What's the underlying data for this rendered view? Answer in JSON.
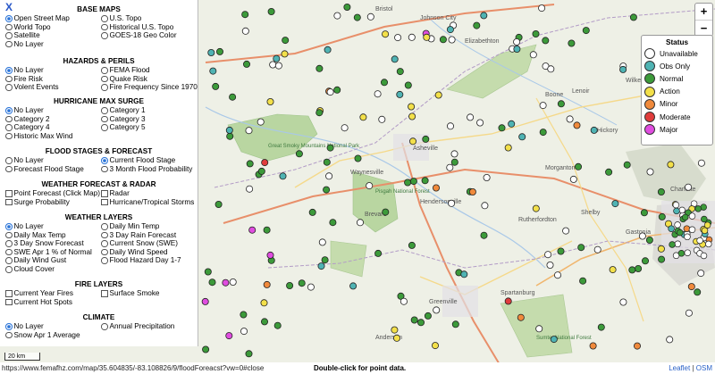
{
  "panel": {
    "close_label": "X",
    "sections": [
      {
        "title": "BASE MAPS",
        "type": "radio",
        "options": [
          {
            "label": "Open Street Map",
            "on": true
          },
          {
            "label": "U.S. Topo",
            "on": false
          },
          {
            "label": "World Topo",
            "on": false
          },
          {
            "label": "Historical U.S. Topo",
            "on": false
          },
          {
            "label": "Satellite",
            "on": false
          },
          {
            "label": "GOES-18 Geo Color",
            "on": false
          },
          {
            "label": "No Layer",
            "on": false
          }
        ]
      },
      {
        "title": "HAZARDS & PERILS",
        "type": "radio",
        "options": [
          {
            "label": "No Layer",
            "on": true
          },
          {
            "label": "FEMA Flood",
            "on": false
          },
          {
            "label": "Fire Risk",
            "on": false
          },
          {
            "label": "Quake Risk",
            "on": false
          },
          {
            "label": "Volent Events",
            "on": false
          },
          {
            "label": "Fire Frequency Since 1970",
            "on": false
          }
        ]
      },
      {
        "title": "HURRICANE MAX SURGE",
        "type": "radio",
        "options": [
          {
            "label": "No Layer",
            "on": true
          },
          {
            "label": "Category 1",
            "on": false
          },
          {
            "label": "Category 2",
            "on": false
          },
          {
            "label": "Category 3",
            "on": false
          },
          {
            "label": "Category 4",
            "on": false
          },
          {
            "label": "Category 5",
            "on": false
          },
          {
            "label": "Historic Max Wind",
            "on": false
          }
        ]
      },
      {
        "title": "FLOOD STAGES & FORECAST",
        "type": "radio",
        "options": [
          {
            "label": "No Layer",
            "on": false
          },
          {
            "label": "Current Flood Stage",
            "on": true
          },
          {
            "label": "Forecast Flood Stage",
            "on": false
          },
          {
            "label": "3 Month Flood Probability",
            "on": false
          }
        ]
      },
      {
        "title": "WEATHER FORECAST & RADAR",
        "type": "check",
        "options": [
          {
            "label": "Point Forecast (Click Map)",
            "on": false
          },
          {
            "label": "Radar",
            "on": false
          },
          {
            "label": "Surge Probability",
            "on": false
          },
          {
            "label": "Hurricane/Tropical Storms",
            "on": false
          }
        ]
      },
      {
        "title": "WEATHER LAYERS",
        "type": "radio",
        "options": [
          {
            "label": "No Layer",
            "on": true
          },
          {
            "label": "Daily Min Temp",
            "on": false
          },
          {
            "label": "Daily Max Temp",
            "on": false
          },
          {
            "label": "3 Day Rain Forecast",
            "on": false
          },
          {
            "label": "3 Day Snow Forecast",
            "on": false
          },
          {
            "label": "Current Snow (SWE)",
            "on": false
          },
          {
            "label": "SWE Apr 1 % of Normal",
            "on": false
          },
          {
            "label": "Daily Wind Speed",
            "on": false
          },
          {
            "label": "Daily Wind Gust",
            "on": false
          },
          {
            "label": "Flood Hazard Day 1-7",
            "on": false
          },
          {
            "label": "Cloud Cover",
            "on": false
          }
        ]
      },
      {
        "title": "FIRE LAYERS",
        "type": "check",
        "options": [
          {
            "label": "Current Year Fires",
            "on": false
          },
          {
            "label": "Surface Smoke",
            "on": false
          },
          {
            "label": "Current Hot Spots",
            "on": false
          }
        ]
      },
      {
        "title": "CLIMATE",
        "type": "radio",
        "options": [
          {
            "label": "No Layer",
            "on": true
          },
          {
            "label": "Annual Precipitation",
            "on": false
          },
          {
            "label": "Snow Apr 1 Average",
            "on": false
          }
        ]
      }
    ]
  },
  "zoom": {
    "in_label": "+",
    "out_label": "−"
  },
  "legend": {
    "title": "Status",
    "items": [
      {
        "label": "Unavailable",
        "color": "#ffffff"
      },
      {
        "label": "Obs Only",
        "color": "#4fb3b3"
      },
      {
        "label": "Normal",
        "color": "#3c9a3a"
      },
      {
        "label": "Action",
        "color": "#f3e04a"
      },
      {
        "label": "Minor",
        "color": "#f08a3c"
      },
      {
        "label": "Moderate",
        "color": "#e03c3c"
      },
      {
        "label": "Major",
        "color": "#e04de0"
      }
    ]
  },
  "map_labels": [
    "Johnson City",
    "Bristol",
    "Elizabethton",
    "Boone",
    "Wilkesboro",
    "Hickory",
    "Morganton",
    "Asheville",
    "Waynesville",
    "Hendersonville",
    "Brevard",
    "Gastonia",
    "Charlotte",
    "Spartanburg",
    "Greenville",
    "Anderson",
    "Rutherfordton",
    "Shelby",
    "Great Smoky Mountains National Park",
    "Pisgah National Forest",
    "Sumter National Forest",
    "Lenoir",
    "Newton"
  ],
  "statusbar": {
    "url": "https://www.femafhz.com/map/35.604835/-83.108826/9/floodForeacst?vw=0#close",
    "hint": "Double-click for point data.",
    "attr_leaflet": "Leaflet",
    "attr_sep": " | ",
    "attr_osm": "OSM"
  },
  "scale": {
    "label": "20 km"
  }
}
